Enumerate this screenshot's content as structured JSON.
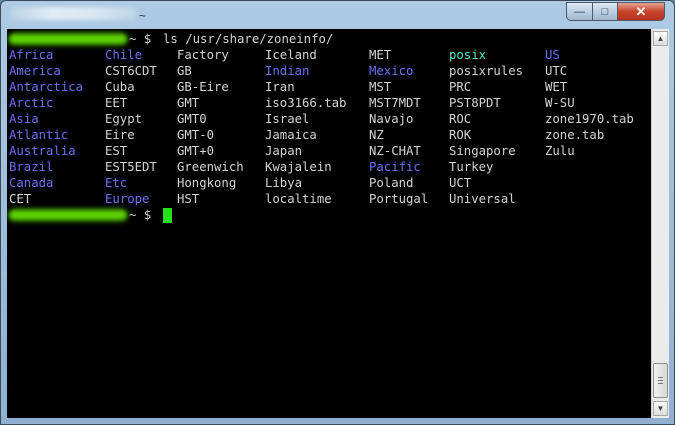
{
  "window": {
    "title_suffix": "~",
    "minimize_label": "—",
    "maximize_label": "□",
    "close_label": "✕"
  },
  "colors": {
    "directory": "#6a70f0",
    "executable": "#4ee8c8",
    "file": "#d3d3d3",
    "cursor": "#22e01a"
  },
  "terminal": {
    "prompt_suffix": "~ $",
    "command": "ls /usr/share/zoneinfo/",
    "rows": [
      [
        "Africa",
        "Chile",
        "Factory",
        "Iceland",
        "MET",
        "posix",
        "US"
      ],
      [
        "America",
        "CST6CDT",
        "GB",
        "Indian",
        "Mexico",
        "posixrules",
        "UTC"
      ],
      [
        "Antarctica",
        "Cuba",
        "GB-Eire",
        "Iran",
        "MST",
        "PRC",
        "WET"
      ],
      [
        "Arctic",
        "EET",
        "GMT",
        "iso3166.tab",
        "MST7MDT",
        "PST8PDT",
        "W-SU"
      ],
      [
        "Asia",
        "Egypt",
        "GMT0",
        "Israel",
        "Navajo",
        "ROC",
        "zone1970.tab"
      ],
      [
        "Atlantic",
        "Eire",
        "GMT-0",
        "Jamaica",
        "NZ",
        "ROK",
        "zone.tab"
      ],
      [
        "Australia",
        "EST",
        "GMT+0",
        "Japan",
        "NZ-CHAT",
        "Singapore",
        "Zulu"
      ],
      [
        "Brazil",
        "EST5EDT",
        "Greenwich",
        "Kwajalein",
        "Pacific",
        "Turkey",
        ""
      ],
      [
        "Canada",
        "Etc",
        "Hongkong",
        "Libya",
        "Poland",
        "UCT",
        ""
      ],
      [
        "CET",
        "Europe",
        "HST",
        "localtime",
        "Portugal",
        "Universal",
        ""
      ]
    ],
    "kinds": [
      [
        "d",
        "d",
        "f",
        "f",
        "f",
        "x",
        "d"
      ],
      [
        "d",
        "f",
        "f",
        "d",
        "d",
        "f",
        "f"
      ],
      [
        "d",
        "f",
        "f",
        "f",
        "f",
        "f",
        "f"
      ],
      [
        "d",
        "f",
        "f",
        "f",
        "f",
        "f",
        "f"
      ],
      [
        "d",
        "f",
        "f",
        "f",
        "f",
        "f",
        "f"
      ],
      [
        "d",
        "f",
        "f",
        "f",
        "f",
        "f",
        "f"
      ],
      [
        "d",
        "f",
        "f",
        "f",
        "f",
        "f",
        "f"
      ],
      [
        "d",
        "f",
        "f",
        "f",
        "d",
        "f",
        ""
      ],
      [
        "d",
        "d",
        "f",
        "f",
        "f",
        "f",
        ""
      ],
      [
        "f",
        "d",
        "f",
        "f",
        "f",
        "f",
        ""
      ]
    ]
  }
}
